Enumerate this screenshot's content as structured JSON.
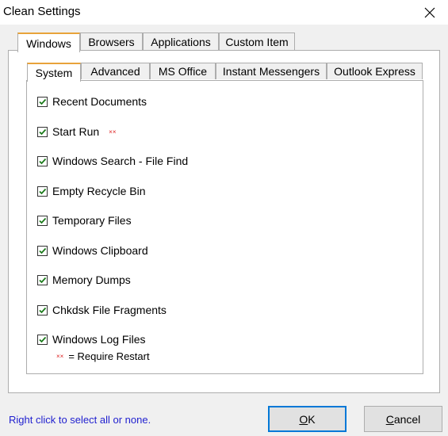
{
  "window": {
    "title": "Clean Settings"
  },
  "outer_tabs": [
    {
      "label": "Windows",
      "selected": true
    },
    {
      "label": "Browsers",
      "selected": false
    },
    {
      "label": "Applications",
      "selected": false
    },
    {
      "label": "Custom Item",
      "selected": false
    }
  ],
  "inner_tabs": [
    {
      "label": "System",
      "selected": true
    },
    {
      "label": "Advanced",
      "selected": false
    },
    {
      "label": "MS Office",
      "selected": false
    },
    {
      "label": "Instant Messengers",
      "selected": false
    },
    {
      "label": "Outlook Express",
      "selected": false
    }
  ],
  "options": [
    {
      "label": "Recent Documents",
      "checked": true,
      "requires_restart": false
    },
    {
      "label": "Start Run",
      "checked": true,
      "requires_restart": true
    },
    {
      "label": "Windows Search - File Find",
      "checked": true,
      "requires_restart": false
    },
    {
      "label": "Empty Recycle Bin",
      "checked": true,
      "requires_restart": false
    },
    {
      "label": "Temporary Files",
      "checked": true,
      "requires_restart": false
    },
    {
      "label": "Windows Clipboard",
      "checked": true,
      "requires_restart": false
    },
    {
      "label": "Memory Dumps",
      "checked": true,
      "requires_restart": false
    },
    {
      "label": "Chkdsk File Fragments",
      "checked": true,
      "requires_restart": false
    },
    {
      "label": "Windows Log Files",
      "checked": true,
      "requires_restart": false
    }
  ],
  "restart_marker": "××",
  "legend": {
    "marker": "××",
    "text": "= Require Restart"
  },
  "hint": "Right click to select all or none.",
  "buttons": {
    "ok": "OK",
    "cancel": "Cancel"
  },
  "colors": {
    "accent": "#e8a33a",
    "hint_text": "#1f1fcf",
    "restart_marker": "#dd2222",
    "checkmark": "#1a7a1a"
  },
  "icons": {
    "close": "close-icon",
    "check": "checkmark-icon"
  }
}
